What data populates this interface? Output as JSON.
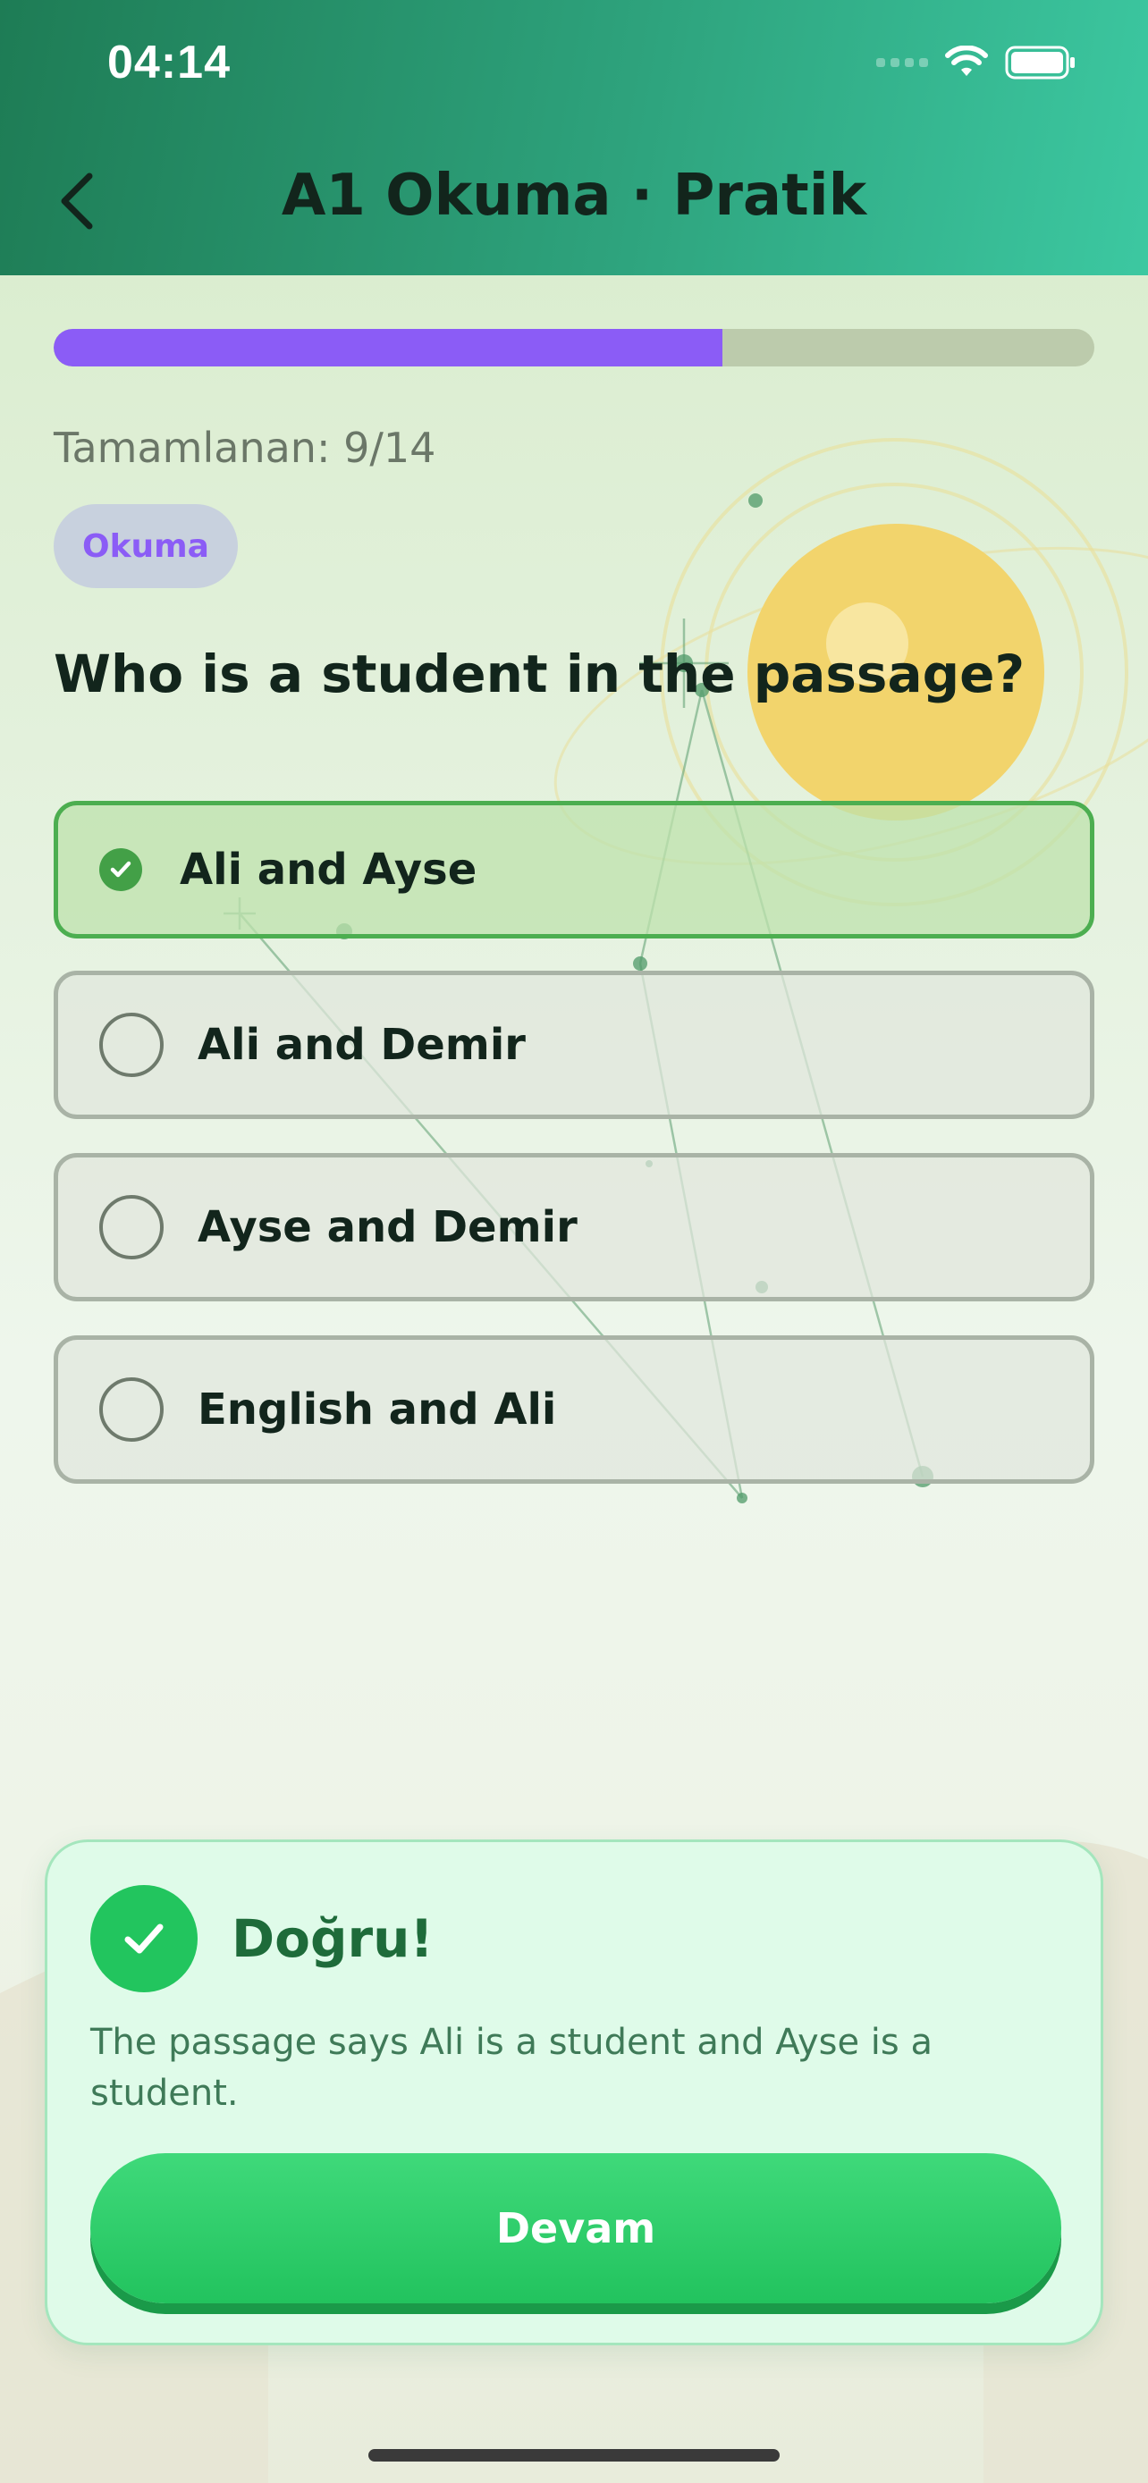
{
  "status_bar": {
    "time": "04:14"
  },
  "header": {
    "title": "A1 Okuma · Pratik"
  },
  "progress": {
    "text": "Tamamlanan: 9/14",
    "fraction": 0.643,
    "color": "#8b5cf6"
  },
  "badge": {
    "label": "Okuma"
  },
  "question": {
    "text": "Who is a student in the passage?"
  },
  "options": [
    {
      "label": "Ali and Ayse",
      "selected": true
    },
    {
      "label": "Ali and Demir",
      "selected": false
    },
    {
      "label": "Ayse and Demir",
      "selected": false
    },
    {
      "label": "English and Ali",
      "selected": false
    }
  ],
  "feedback": {
    "title": "Doğru!",
    "explanation": "The passage says Ali is a student and Ayse is a student.",
    "button_label": "Devam"
  },
  "colors": {
    "accent": "#8b5cf6",
    "success": "#22c55e",
    "header": "#2ea37d"
  },
  "icons": {
    "back": "chevron-left-icon",
    "wifi": "wifi-icon",
    "battery": "battery-icon",
    "check": "check-icon"
  }
}
